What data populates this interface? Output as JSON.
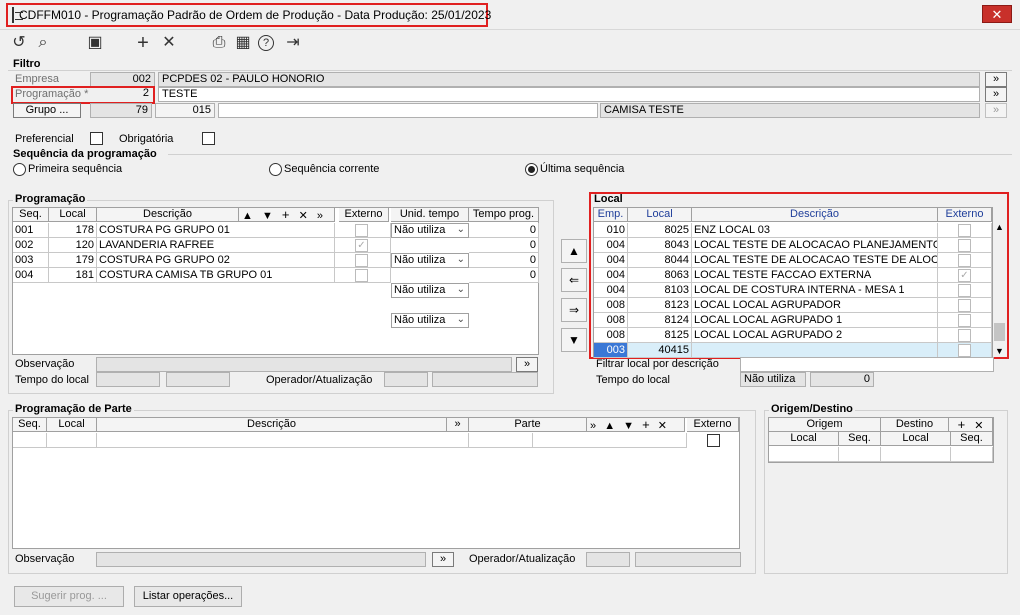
{
  "window": {
    "title": "CDFFM010 - Programação Padrão de Ordem de Produção - Data Produção: 25/01/2023",
    "close": "✕"
  },
  "toolbar": {
    "undo": "↺",
    "search": "⌕",
    "save": "▣",
    "add": "+",
    "remove": "✕",
    "print": "⎙",
    "calendar": "▦",
    "help": "?",
    "exit": "⇥"
  },
  "filtro": {
    "title": "Filtro",
    "empresa_label": "Empresa",
    "empresa_code": "002",
    "empresa_name": "PCPDES 02 - PAULO HONORIO",
    "programacao_label": "Programação *",
    "programacao_value": "2",
    "programacao_name": "TESTE",
    "grupo_button": "Grupo ...",
    "grupo_value1": "79",
    "grupo_value2": "015",
    "grupo_name": "CAMISA TESTE",
    "more": "»",
    "preferencial_label": "Preferencial",
    "obrigatoria_label": "Obrigatória"
  },
  "sequencia": {
    "title": "Sequência da programação",
    "options": [
      "Primeira sequência",
      "Sequência corrente",
      "Última sequência"
    ],
    "selected": "Última sequência"
  },
  "programacao": {
    "title": "Programação",
    "headers": [
      "Seq.",
      "Local",
      "Descrição",
      "Externo",
      "Unid. tempo",
      "Tempo prog."
    ],
    "rows": [
      {
        "seq": "001",
        "local": "178",
        "desc": "COSTURA PG GRUPO 01",
        "externo": false,
        "unid": "Não utiliza",
        "tempo": "0"
      },
      {
        "seq": "002",
        "local": "120",
        "desc": "LAVANDERIA RAFREE",
        "externo": true,
        "unid": "Não utiliza",
        "tempo": "0"
      },
      {
        "seq": "003",
        "local": "179",
        "desc": "COSTURA PG GRUPO 02",
        "externo": false,
        "unid": "Não utiliza",
        "tempo": "0"
      },
      {
        "seq": "004",
        "local": "181",
        "desc": "COSTURA CAMISA TB GRUPO 01",
        "externo": false,
        "unid": "Não utiliza",
        "tempo": "0"
      }
    ],
    "observacao_label": "Observação",
    "tempo_local_label": "Tempo do local",
    "operador_label": "Operador/Atualização"
  },
  "local": {
    "title": "Local",
    "headers": [
      "Emp.",
      "Local",
      "Descrição",
      "Externo"
    ],
    "rows": [
      {
        "emp": "010",
        "local": "8025",
        "desc": "ENZ LOCAL 03",
        "externo": false
      },
      {
        "emp": "004",
        "local": "8043",
        "desc": "LOCAL TESTE DE ALOCACAO PLANEJAMENTO",
        "externo": false
      },
      {
        "emp": "004",
        "local": "8044",
        "desc": "LOCAL TESTE DE ALOCACAO TESTE DE ALOCAC",
        "externo": false
      },
      {
        "emp": "004",
        "local": "8063",
        "desc": "LOCAL TESTE FACCAO EXTERNA",
        "externo": true
      },
      {
        "emp": "004",
        "local": "8103",
        "desc": "LOCAL DE COSTURA INTERNA - MESA 1",
        "externo": false
      },
      {
        "emp": "008",
        "local": "8123",
        "desc": "LOCAL LOCAL AGRUPADOR",
        "externo": false
      },
      {
        "emp": "008",
        "local": "8124",
        "desc": "LOCAL LOCAL AGRUPADO 1",
        "externo": false
      },
      {
        "emp": "008",
        "local": "8125",
        "desc": "LOCAL LOCAL AGRUPADO 2",
        "externo": false
      },
      {
        "emp": "003",
        "local": "40415",
        "desc": "",
        "externo": false
      }
    ],
    "filtrar_label": "Filtrar local por descrição",
    "tempo_local_label": "Tempo do local",
    "tempo_unid": "Não utiliza",
    "tempo_value": "0"
  },
  "parte": {
    "title": "Programação de Parte",
    "headers": [
      "Seq.",
      "Local",
      "Descrição",
      "Parte",
      "Externo"
    ],
    "observacao_label": "Observação",
    "operador_label": "Operador/Atualização"
  },
  "origem": {
    "title": "Origem/Destino",
    "origem_label": "Origem",
    "destino_label": "Destino",
    "sub_headers": [
      "Local",
      "Seq.",
      "Local",
      "Seq."
    ]
  },
  "footer": {
    "sugerir": "Sugerir prog. ...",
    "listar": "Listar operações..."
  }
}
